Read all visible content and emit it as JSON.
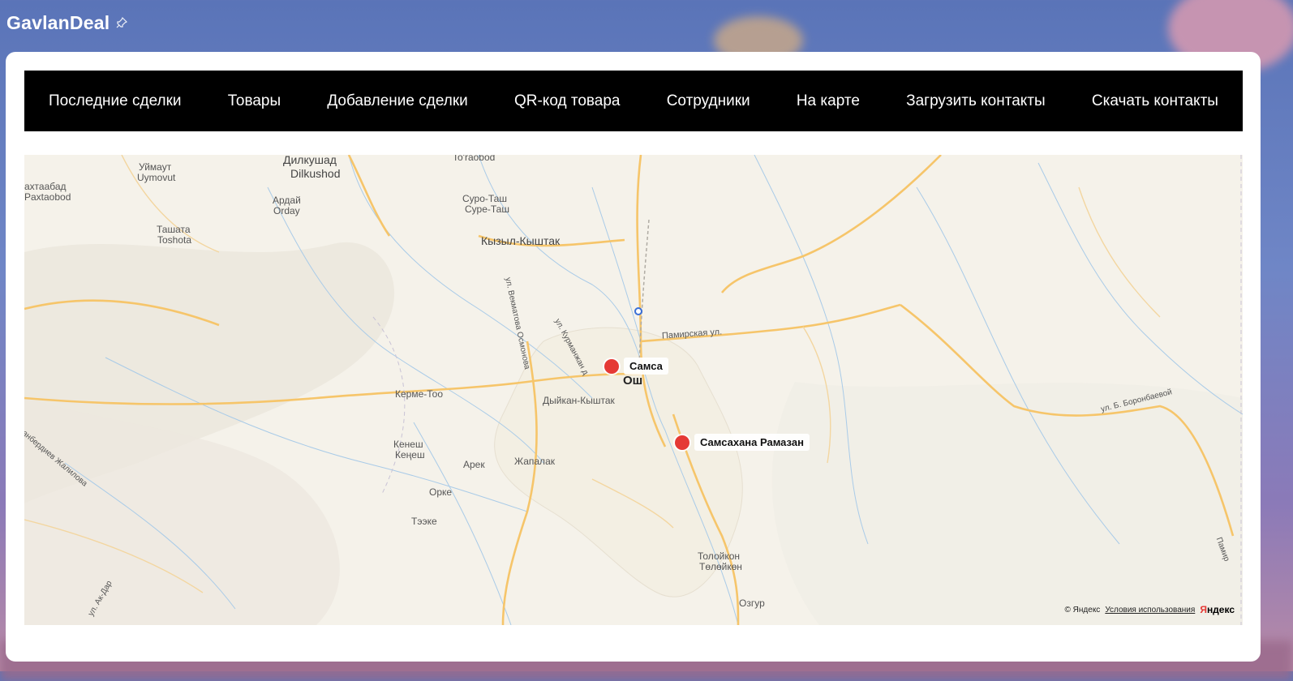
{
  "app": {
    "title": "GavlanDeal",
    "pin_icon": "pin-icon"
  },
  "nav": {
    "items": [
      "Последние сделки",
      "Товары",
      "Добавление сделки",
      "QR-код товара",
      "Сотрудники",
      "На карте",
      "Загрузить контакты",
      "Скачать контакты"
    ]
  },
  "map": {
    "labels": {
      "dilkushad": "Дилкушад",
      "dilkushod": "Dilkushod",
      "uymaut": "Уймаут",
      "uymovut": "Uymovut",
      "pakhtaabad": "ахтаабад",
      "paxtaobod": "Paxtaobod",
      "ardai": "Ардай",
      "orday": "Orday",
      "tashata": "Ташата",
      "toshota": "Toshota",
      "toraobod": "To'raobod",
      "suro_tash": "Суро-Таш",
      "sure_tash": "Суре-Таш",
      "kyzyl_kyshtak": "Кызыл-Кыштак",
      "kerme_too": "Керме-Тоо",
      "dyikan_kyshtak": "Дыйкан-Кыштак",
      "osh": "Ош",
      "kenesh": "Кенеш",
      "kenesh2": "Кеңеш",
      "arek": "Арек",
      "zhapalak": "Жапалак",
      "orke": "Орке",
      "teeke": "Тээке",
      "toloikon": "Толойкон",
      "toloikon2": "Төлөйкөн",
      "ozgur": "Озгур",
      "pamirskaya": "Памирская ул.",
      "kurmanzhan": "ул. Курманжан д",
      "vekmatova": "ул. Векматова Осмонова",
      "boronbaeva": "ул. Б. Боронбаевой",
      "mambetov": "ганбердиев Жалилова",
      "ak_dar": "ул. Ак-Дар",
      "pamir_edge": "Памир"
    },
    "markers": [
      {
        "label": "Самса"
      },
      {
        "label": "Самсахана Рамазан"
      }
    ],
    "copyright": {
      "owner": "© Яндекс",
      "terms": "Условия использования",
      "logo_y": "Я",
      "logo_rest": "ндекс"
    }
  }
}
